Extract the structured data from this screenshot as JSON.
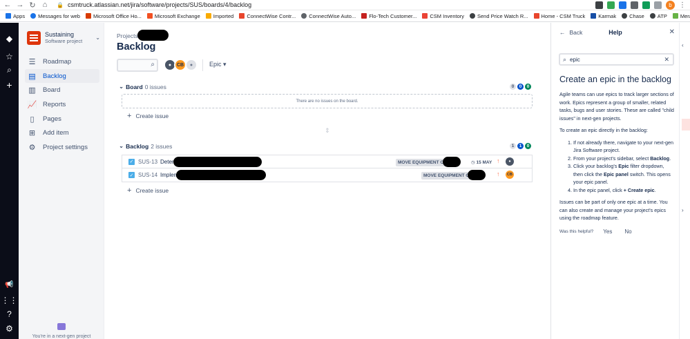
{
  "browser": {
    "url": "csmtruck.atlassian.net/jira/software/projects/SUS/boards/4/backlog",
    "profile_initial": "b",
    "bookmarks": [
      "Apps",
      "Messages for web",
      "Microsoft Office Ho...",
      "Microsoft Exchange",
      "Imported",
      "ConnectWise Contr...",
      "ConnectWise Auto...",
      "Flo-Tech Customer...",
      "CSM Inventory",
      "Send Price Watch R...",
      "Home - CSM Truck",
      "Karmak",
      "Chase",
      "ATP",
      "Meraki Dashboard..."
    ]
  },
  "sidebar": {
    "project_name": "Sustaining",
    "project_type": "Software project",
    "items": [
      {
        "label": "Roadmap"
      },
      {
        "label": "Backlog"
      },
      {
        "label": "Board"
      },
      {
        "label": "Reports"
      },
      {
        "label": "Pages"
      },
      {
        "label": "Add item"
      },
      {
        "label": "Project settings"
      }
    ],
    "footer": "You're in a next-gen project"
  },
  "main": {
    "breadcrumb": "Projects",
    "title": "Backlog",
    "avatar_initials": "CB",
    "epic_filter": "Epic",
    "board": {
      "label": "Board",
      "count": "0 issues",
      "pills": [
        "0",
        "0",
        "0"
      ],
      "empty_text": "There are no issues on the board.",
      "create_label": "Create issue"
    },
    "backlog": {
      "label": "Backlog",
      "count": "2 issues",
      "pills": [
        "1",
        "1",
        "0"
      ],
      "create_label": "Create issue",
      "issues": [
        {
          "key": "SUS-13",
          "summary": "Determi",
          "epic": "MOVE EQUIPMENT OUT",
          "date": "15 MAY"
        },
        {
          "key": "SUS-14",
          "summary": "Impleme",
          "epic": "MOVE EQUIPMENT OUT",
          "assignee": "CB"
        }
      ]
    }
  },
  "help": {
    "back_label": "Back",
    "title": "Help",
    "search_value": "epic",
    "article_title": "Create an epic in the backlog",
    "para1": "Agile teams can use epics to track larger sections of work. Epics represent a group of smaller, related tasks, bugs and user stories. These are called \"child issues\" in next-gen projects.",
    "para2": "To create an epic directly in the backlog:",
    "step1": "If not already there, navigate to your next-gen Jira Software project.",
    "step2_a": "From your project's sidebar, select ",
    "step2_b": "Backlog",
    "step2_c": ".",
    "step3_a": "Click your backlog's ",
    "step3_b": "Epic",
    "step3_c": " filter dropdown, then click the ",
    "step3_d": "Epic panel",
    "step3_e": " switch. This opens your epic panel.",
    "step4_a": "In the epic panel, click ",
    "step4_b": "+ Create epic",
    "step4_c": ".",
    "para3": "Issues can be part of only one epic at a time. You can also create and manage your project's epics using the roadmap feature.",
    "helpful_q": "Was this helpful?",
    "yes": "Yes",
    "no": "No"
  },
  "colors": {
    "global_nav": "#0b0d18",
    "brand_blue": "#0052cc",
    "project_logo": "#de350b",
    "story_check": "#4bade8",
    "priority": "#ff7452"
  }
}
